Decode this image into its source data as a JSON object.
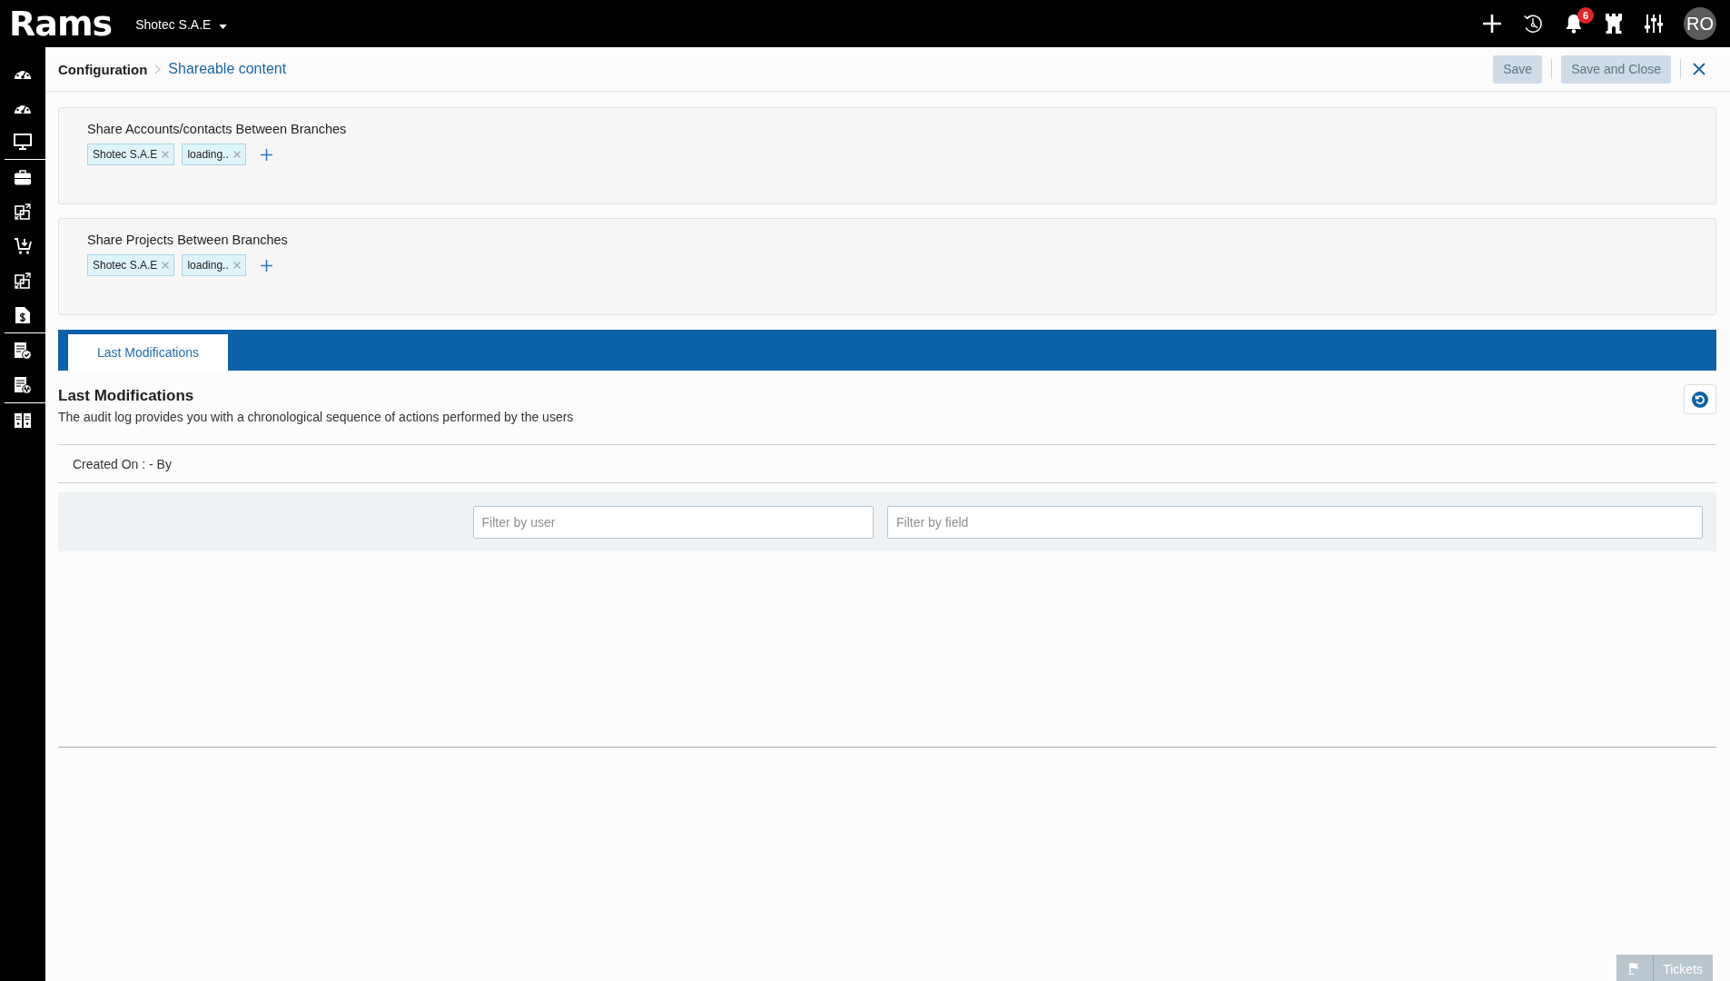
{
  "top_bar": {
    "logo": "Rams",
    "company": "Shotec S.A.E",
    "notification_count": "6",
    "user_initials": "RO"
  },
  "header": {
    "breadcrumb": [
      {
        "label": "Configuration",
        "current": false
      },
      {
        "label": "Shareable content",
        "current": true
      }
    ],
    "buttons": [
      {
        "label": "Save",
        "disabled": true
      },
      {
        "label": "Save and Close",
        "disabled": true
      }
    ]
  },
  "sections": [
    {
      "title": "Share Accounts/contacts Between Branches",
      "tags": [
        "Shotec S.A.E",
        "loading.."
      ]
    },
    {
      "title": "Share Projects Between Branches",
      "tags": [
        "Shotec S.A.E",
        "loading.."
      ]
    }
  ],
  "tabs": [
    {
      "label": "Last Modifications",
      "selected": true
    }
  ],
  "audit_log": {
    "title": "Last Modifications",
    "description": "The audit log provides you with a chronological sequence of actions performed by the users",
    "created_info": "Created On : - By",
    "filters": [
      {
        "placeholder": "Filter by user"
      },
      {
        "placeholder": "Filter by field"
      }
    ]
  },
  "tickets_button": {
    "label": "Tickets"
  }
}
